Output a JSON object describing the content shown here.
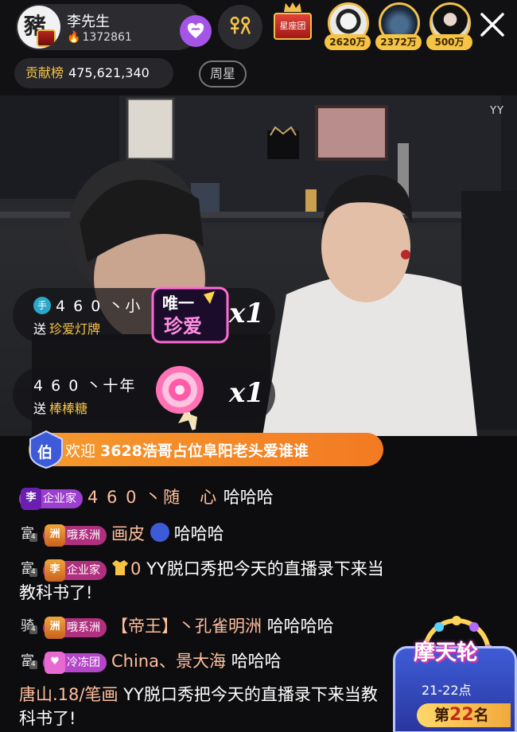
{
  "header": {
    "host": {
      "avatar_glyph": "豬",
      "name": "李先生",
      "fans": "1372861"
    },
    "constellation_label": "星座团",
    "viewers": [
      {
        "amount": "2620万"
      },
      {
        "amount": "2372万"
      },
      {
        "amount": "500万"
      }
    ],
    "contribution": {
      "label": "贡献榜",
      "value": "475,621,340"
    },
    "week_star_label": "周星"
  },
  "video": {
    "watermark": "YY"
  },
  "gifts": [
    {
      "level": "手",
      "user": "4 6 0 丶小",
      "action": "送",
      "gift_name": "珍爱灯牌",
      "count": "x1"
    },
    {
      "user": "4 6 0 丶十年",
      "action": "送",
      "gift_name": "棒棒糖",
      "count": "x1"
    }
  ],
  "welcome": {
    "shield": "伯",
    "prefix": "欢迎",
    "name": "3628浩哥占位阜阳老头爱谁谁"
  },
  "chat": [
    {
      "club_icon": "李",
      "club_level": "10",
      "club": "企业家",
      "user": "4 6 0 丶随　心",
      "text": "哈哈哈"
    },
    {
      "rank": "富",
      "rank_level": "4",
      "club_icon": "洲",
      "club_level": "9",
      "club": "哦系洲",
      "user": "画皮",
      "text": "哈哈哈"
    },
    {
      "rank": "富",
      "rank_level": "4",
      "club_icon": "李",
      "club_level": "2",
      "club": "企业家",
      "shirt_num": "0",
      "text": "YY脱口秀把今天的直播录下来当教科书了!"
    },
    {
      "rank": "骑",
      "rank_level": "4",
      "club_icon": "洲",
      "club_level": "10",
      "club": "哦系洲",
      "user": "【帝王】丶孔雀明洲",
      "text": "哈哈哈哈"
    },
    {
      "rank": "富",
      "rank_level": "4",
      "club_icon": "♥",
      "club_level": "7",
      "club": "冷冻团",
      "user": "China、景大海",
      "text": "哈哈哈"
    },
    {
      "user": "唐山.18/笔画",
      "text": "YY脱口秀把今天的直播录下来当教科书了!"
    }
  ],
  "promo": {
    "title": "摩天轮",
    "time": "21-22点",
    "rank_prefix": "第",
    "rank_number": "22",
    "rank_suffix": "名"
  },
  "colors": {
    "gold": "#f5c445",
    "orange_banner": "#f37a22",
    "follow_purple": "#a455e8",
    "promo_blue": "#3e5cd6"
  }
}
